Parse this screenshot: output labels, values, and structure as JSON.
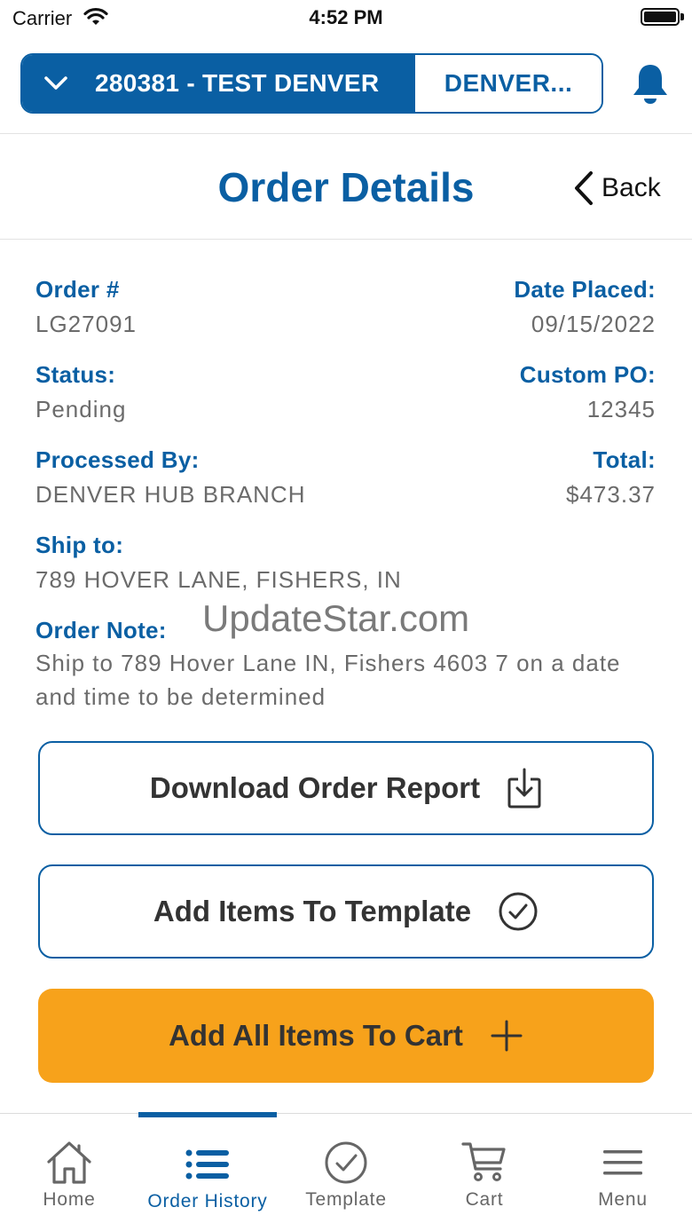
{
  "status_bar": {
    "carrier": "Carrier",
    "time": "4:52 PM"
  },
  "account": {
    "name": "280381 - TEST DENVER",
    "branch": "DENVER..."
  },
  "header": {
    "title": "Order Details",
    "back_label": "Back"
  },
  "order": {
    "order_number_label": "Order #",
    "order_number": "LG27091",
    "date_placed_label": "Date Placed:",
    "date_placed": "09/15/2022",
    "status_label": "Status:",
    "status": "Pending",
    "custom_po_label": "Custom PO:",
    "custom_po": "12345",
    "processed_by_label": "Processed By:",
    "processed_by": "DENVER HUB BRANCH",
    "total_label": "Total:",
    "total": "$473.37",
    "ship_to_label": "Ship to:",
    "ship_to": "789 HOVER LANE, FISHERS, IN",
    "order_note_label": "Order Note:",
    "order_note": "Ship to 789 Hover Lane IN, Fishers 4603 7 on a date and time to be determined"
  },
  "watermark": "UpdateStar.com",
  "actions": {
    "download_report": "Download Order Report",
    "add_to_template": "Add Items To Template",
    "add_to_cart": "Add All Items To Cart"
  },
  "tabs": [
    {
      "label": "Home",
      "icon": "home-icon"
    },
    {
      "label": "Order History",
      "icon": "list-icon"
    },
    {
      "label": "Template",
      "icon": "check-circle-icon"
    },
    {
      "label": "Cart",
      "icon": "cart-icon"
    },
    {
      "label": "Menu",
      "icon": "menu-icon"
    }
  ],
  "colors": {
    "brand_blue": "#0a5fa3",
    "accent_orange": "#f7a21b",
    "muted_text": "#6b6b6b"
  }
}
